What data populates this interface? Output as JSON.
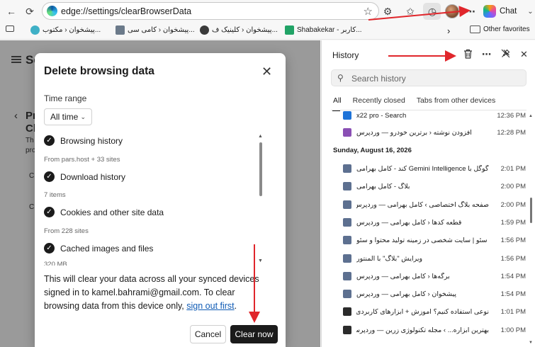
{
  "toolbar": {
    "url": "edge://settings/clearBrowserData",
    "chat_label": "Chat"
  },
  "favorites": {
    "items": [
      {
        "label": "پیشخوان ‹ مکتوب...",
        "color": "#3fb0c6"
      },
      {
        "label": "پیشخوان ‹ کامی سی...",
        "color": "#6b7a8a"
      },
      {
        "label": "پیشخوان ‹ کلینیک ف...",
        "color": "#3a3a3a"
      },
      {
        "label": "Shabakekar - کاربر...",
        "color": "#21a366"
      }
    ],
    "other_label": "Other favorites"
  },
  "settings_page": {
    "title_frag_1": "Se",
    "title_frag_2": "Pr",
    "title_frag_3": "Cl",
    "small_1": "Th",
    "small_2": "pro",
    "small_3": "C",
    "small_4": "C"
  },
  "dialog": {
    "title": "Delete browsing data",
    "time_range_label": "Time range",
    "time_range_value": "All time",
    "options": [
      {
        "label": "Browsing history",
        "detail": "From pars.host + 33 sites",
        "checked": true
      },
      {
        "label": "Download history",
        "detail": "7 items",
        "checked": true
      },
      {
        "label": "Cookies and other site data",
        "detail": "From 228 sites",
        "checked": true
      },
      {
        "label": "Cached images and files",
        "detail": "320 MB",
        "checked": true
      }
    ],
    "info_text": "This will clear your data across all your synced devices signed in to kamel.bahrami@gmail.com. To clear browsing data from this device only, ",
    "info_link": "sign out first",
    "info_end": ".",
    "cancel_label": "Cancel",
    "clear_label": "Clear now"
  },
  "history": {
    "title": "History",
    "search_placeholder": "Search history",
    "tabs": [
      "All",
      "Recently closed",
      "Tabs from other devices"
    ],
    "active_tab": "All",
    "top_items": [
      {
        "title": "x22 pro - Search",
        "time": "12:36 PM",
        "icon": "#1e73d8"
      },
      {
        "title": "افزودن نوشته ‹ برترین خودرو — وردپرس",
        "time": "12:28 PM",
        "icon": "#8a4fb4"
      }
    ],
    "date_header": "Sunday, August 16, 2026",
    "items": [
      {
        "title": "گوگل با Gemini Intelligence کند - کامل بهرامی",
        "time": "2:01 PM",
        "icon": "#5d7090"
      },
      {
        "title": "بلاگ - کامل بهرامی",
        "time": "2:00 PM",
        "icon": "#5d7090"
      },
      {
        "title": "صفحه بلاگ اختصاصی › کامل بهرامی — وردپرس",
        "time": "2:00 PM",
        "icon": "#5d7090"
      },
      {
        "title": "قطعه کدها ‹ کامل بهرامی — وردپرس",
        "time": "1:59 PM",
        "icon": "#5d7090"
      },
      {
        "title": "سئو | سایت شخصی در زمینه تولید محتوا و سئو",
        "time": "1:56 PM",
        "icon": "#5d7090"
      },
      {
        "title": "ویرایش \"بلاگ\" با المنتور",
        "time": "1:56 PM",
        "icon": "#5d7090"
      },
      {
        "title": "برگه‌ها ‹ کامل بهرامی — وردپرس",
        "time": "1:54 PM",
        "icon": "#5d7090"
      },
      {
        "title": "پیشخوان ‹ کامل بهرامی — وردپرس",
        "time": "1:54 PM",
        "icon": "#5d7090"
      },
      {
        "title": "نوعی استفاده کنیم؟ آموزش + ابزارهای کاربردی",
        "time": "1:01 PM",
        "icon": "#2b2b2b"
      },
      {
        "title": "بهترین ابزاره... › مجله تکنولوژی زرین — وردپرس",
        "time": "1:00 PM",
        "icon": "#2b2b2b"
      }
    ]
  },
  "colors": {
    "annotation_red": "#e0262b",
    "primary_button": "#1b1b1b",
    "link": "#0f5bb5"
  }
}
